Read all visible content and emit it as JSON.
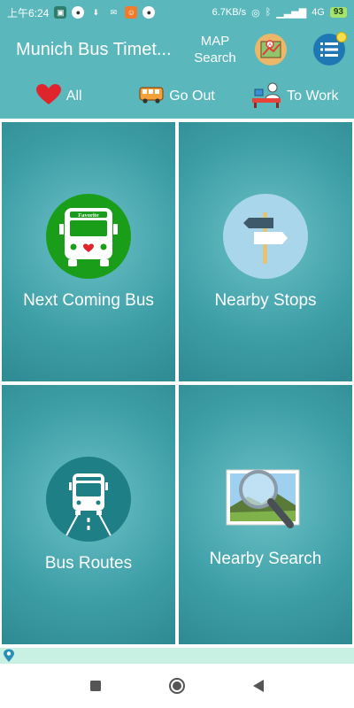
{
  "status_bar": {
    "time": "上午6:24",
    "net_speed": "6.7KB/s",
    "network": "4G",
    "battery": "93"
  },
  "header": {
    "title": "Munich Bus Timet...",
    "map_search_line1": "MAP",
    "map_search_line2": "Search"
  },
  "filters": [
    {
      "label": "All",
      "icon": "heart-icon"
    },
    {
      "label": "Go Out",
      "icon": "bus-icon"
    },
    {
      "label": "To Work",
      "icon": "desk-worker-icon"
    }
  ],
  "tiles": [
    {
      "label": "Next Coming Bus",
      "icon": "favorite-bus-icon",
      "badge": "Favorite"
    },
    {
      "label": "Nearby Stops",
      "icon": "signpost-icon"
    },
    {
      "label": "Bus Routes",
      "icon": "bus-front-icon"
    },
    {
      "label": "Nearby Search",
      "icon": "magnifier-photo-icon"
    }
  ],
  "colors": {
    "header_bg": "#5ab8bd",
    "tile_bg": "#3d9ea6",
    "favorite_green": "#1a9e1a",
    "heart_red": "#e0242b"
  }
}
